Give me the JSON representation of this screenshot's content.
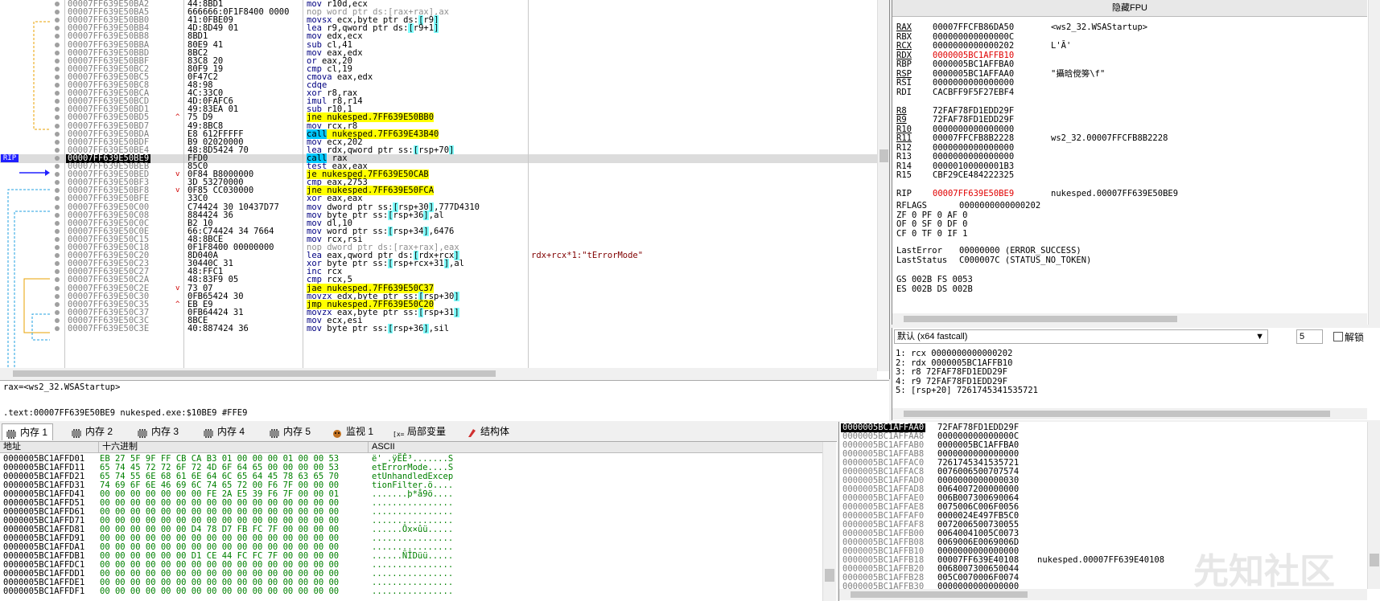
{
  "disasm": {
    "rows": [
      {
        "addr": "00007FF639E50BA2",
        "bytes": "44:8BD1",
        "ins": "mov r10d,ecx",
        "type": "normal"
      },
      {
        "addr": "00007FF639E50BA5",
        "bytes": "666666:0F1F8400 0000",
        "ins": "nop word ptr ds:[rax+rax],ax",
        "type": "nop"
      },
      {
        "addr": "00007FF639E50BB0",
        "bytes": "41:0FBE09",
        "ins": "movsx ecx,byte ptr ds:[r9]",
        "type": "normal"
      },
      {
        "addr": "00007FF639E50BB4",
        "bytes": "4D:8D49 01",
        "ins": "lea r9,qword ptr ds:[r9+1]",
        "type": "normal"
      },
      {
        "addr": "00007FF639E50BB8",
        "bytes": "8BD1",
        "ins": "mov edx,ecx",
        "type": "normal"
      },
      {
        "addr": "00007FF639E50BBA",
        "bytes": "80E9 41",
        "ins": "sub cl,41",
        "type": "normal"
      },
      {
        "addr": "00007FF639E50BBD",
        "bytes": "8BC2",
        "ins": "mov eax,edx",
        "type": "normal"
      },
      {
        "addr": "00007FF639E50BBF",
        "bytes": "83C8 20",
        "ins": "or eax,20",
        "type": "normal"
      },
      {
        "addr": "00007FF639E50BC2",
        "bytes": "80F9 19",
        "ins": "cmp cl,19",
        "type": "normal"
      },
      {
        "addr": "00007FF639E50BC5",
        "bytes": "0F47C2",
        "ins": "cmova eax,edx",
        "type": "normal"
      },
      {
        "addr": "00007FF639E50BC8",
        "bytes": "48:98",
        "ins": "cdqe",
        "type": "normal"
      },
      {
        "addr": "00007FF639E50BCA",
        "bytes": "4C:33C0",
        "ins": "xor r8,rax",
        "type": "normal"
      },
      {
        "addr": "00007FF639E50BCD",
        "bytes": "4D:0FAFC6",
        "ins": "imul r8,r14",
        "type": "normal"
      },
      {
        "addr": "00007FF639E50BD1",
        "bytes": "49:83EA 01",
        "ins": "sub r10,1",
        "type": "normal"
      },
      {
        "addr": "00007FF639E50BD5",
        "bytes": "75 D9",
        "ins": "jne nukesped.7FF639E50BB0",
        "type": "jmp",
        "arrow": "^"
      },
      {
        "addr": "00007FF639E50BD7",
        "bytes": "49:8BC8",
        "ins": "mov rcx,r8",
        "type": "normal"
      },
      {
        "addr": "00007FF639E50BDA",
        "bytes": "E8 612FFFFF",
        "ins": "call nukesped.7FF639E43B40",
        "type": "call"
      },
      {
        "addr": "00007FF639E50BDF",
        "bytes": "B9 02020000",
        "ins": "mov ecx,202",
        "type": "normal"
      },
      {
        "addr": "00007FF639E50BE4",
        "bytes": "48:8D5424 70",
        "ins": "lea rdx,qword ptr ss:[rsp+70]",
        "type": "normal"
      },
      {
        "addr": "00007FF639E50BE9",
        "bytes": "FFD0",
        "ins": "call rax",
        "type": "callreg",
        "current": true
      },
      {
        "addr": "00007FF639E50BEB",
        "bytes": "85C0",
        "ins": "test eax,eax",
        "type": "normal"
      },
      {
        "addr": "00007FF639E50BED",
        "bytes": "0F84 B8000000",
        "ins": "je nukesped.7FF639E50CAB",
        "type": "jmp",
        "arrow": "v"
      },
      {
        "addr": "00007FF639E50BF3",
        "bytes": "3D 53270000",
        "ins": "cmp eax,2753",
        "type": "normal"
      },
      {
        "addr": "00007FF639E50BF8",
        "bytes": "0F85 CC030000",
        "ins": "jne nukesped.7FF639E50FCA",
        "type": "jmp",
        "arrow": "v"
      },
      {
        "addr": "00007FF639E50BFE",
        "bytes": "33C0",
        "ins": "xor eax,eax",
        "type": "normal"
      },
      {
        "addr": "00007FF639E50C00",
        "bytes": "C74424 30 10437D77",
        "ins": "mov dword ptr ss:[rsp+30],777D4310",
        "type": "normal"
      },
      {
        "addr": "00007FF639E50C08",
        "bytes": "884424 36",
        "ins": "mov byte ptr ss:[rsp+36],al",
        "type": "normal"
      },
      {
        "addr": "00007FF639E50C0C",
        "bytes": "B2 10",
        "ins": "mov dl,10",
        "type": "normal"
      },
      {
        "addr": "00007FF639E50C0E",
        "bytes": "66:C74424 34 7664",
        "ins": "mov word ptr ss:[rsp+34],6476",
        "type": "normal"
      },
      {
        "addr": "00007FF639E50C15",
        "bytes": "48:8BCE",
        "ins": "mov rcx,rsi",
        "type": "normal"
      },
      {
        "addr": "00007FF639E50C18",
        "bytes": "0F1F8400 00000000",
        "ins": "nop dword ptr ds:[rax+rax],eax",
        "type": "nop"
      },
      {
        "addr": "00007FF639E50C20",
        "bytes": "8D040A",
        "ins": "lea eax,qword ptr ds:[rdx+rcx]",
        "type": "normal",
        "comment": "rdx+rcx*1:\"tErrorMode\""
      },
      {
        "addr": "00007FF639E50C23",
        "bytes": "30440C 31",
        "ins": "xor byte ptr ss:[rsp+rcx+31],al",
        "type": "normal"
      },
      {
        "addr": "00007FF639E50C27",
        "bytes": "48:FFC1",
        "ins": "inc rcx",
        "type": "normal"
      },
      {
        "addr": "00007FF639E50C2A",
        "bytes": "48:83F9 05",
        "ins": "cmp rcx,5",
        "type": "normal"
      },
      {
        "addr": "00007FF639E50C2E",
        "bytes": "73 07",
        "ins": "jae nukesped.7FF639E50C37",
        "type": "jmp",
        "arrow": "v"
      },
      {
        "addr": "00007FF639E50C30",
        "bytes": "0FB65424 30",
        "ins": "movzx edx,byte ptr ss:[rsp+30]",
        "type": "normal"
      },
      {
        "addr": "00007FF639E50C35",
        "bytes": "EB E9",
        "ins": "jmp nukesped.7FF639E50C20",
        "type": "jmp",
        "arrow": "^"
      },
      {
        "addr": "00007FF639E50C37",
        "bytes": "0FB64424 31",
        "ins": "movzx eax,byte ptr ss:[rsp+31]",
        "type": "normal"
      },
      {
        "addr": "00007FF639E50C3C",
        "bytes": "8BCE",
        "ins": "mov ecx,esi",
        "type": "normal"
      },
      {
        "addr": "00007FF639E50C3E",
        "bytes": "40:887424 36",
        "ins": "mov byte ptr ss:[rsp+36],sil",
        "type": "normal"
      }
    ],
    "rip_label": "RIP"
  },
  "info": {
    "line1": "rax=<ws2_32.WSAStartup>",
    "line2": ".text:00007FF639E50BE9 nukesped.exe:$10BE9 #FFE9"
  },
  "registers": {
    "title": "隐藏FPU",
    "rows": [
      {
        "name": "RAX",
        "value": "00007FFCFB86DA50",
        "comment": "<ws2_32.WSAStartup>",
        "u": true
      },
      {
        "name": "RBX",
        "value": "000000000000000C",
        "comment": ""
      },
      {
        "name": "RCX",
        "value": "0000000000000202",
        "comment": "L'Ȃ'",
        "u": true
      },
      {
        "name": "RDX",
        "value": "0000005BC1AFFB10",
        "comment": "",
        "u": true,
        "red": true
      },
      {
        "name": "RBP",
        "value": "0000005BC1AFFBA0",
        "comment": ""
      },
      {
        "name": "RSP",
        "value": "0000005BC1AFFAA0",
        "comment": "\"攝晗傥篣\\f\"",
        "u": true
      },
      {
        "name": "RSI",
        "value": "0000000000000000",
        "comment": ""
      },
      {
        "name": "RDI",
        "value": "CACBFF9F5F27EBF4",
        "comment": ""
      },
      {
        "name": "",
        "value": "",
        "comment": ""
      },
      {
        "name": "R8",
        "value": "72FAF78FD1EDD29F",
        "comment": "",
        "u": true
      },
      {
        "name": "R9",
        "value": "72FAF78FD1EDD29F",
        "comment": "",
        "u": true
      },
      {
        "name": "R10",
        "value": "0000000000000000",
        "comment": "",
        "u": true
      },
      {
        "name": "R11",
        "value": "00007FFCFB8B2228",
        "comment": "ws2_32.00007FFCFB8B2228",
        "u": true
      },
      {
        "name": "R12",
        "value": "0000000000000000",
        "comment": ""
      },
      {
        "name": "R13",
        "value": "0000000000000000",
        "comment": ""
      },
      {
        "name": "R14",
        "value": "00000100000001B3",
        "comment": ""
      },
      {
        "name": "R15",
        "value": "CBF29CE484222325",
        "comment": ""
      },
      {
        "name": "",
        "value": "",
        "comment": ""
      },
      {
        "name": "RIP",
        "value": "00007FF639E50BE9",
        "comment": "nukesped.00007FF639E50BE9",
        "red": true
      }
    ],
    "rflags_label": "RFLAGS",
    "rflags_value": "0000000000000202",
    "flags": [
      "ZF 0   PF 0   AF 0",
      "OF 0   SF 0   DF 0",
      "CF 0   TF 0   IF 1"
    ],
    "lasterror_label": "LastError",
    "lasterror_value": "00000000 (ERROR_SUCCESS)",
    "laststatus_label": "LastStatus",
    "laststatus_value": "C000007C (STATUS_NO_TOKEN)",
    "segs": [
      "GS 002B  FS 0053",
      "ES 002B  DS 002B"
    ]
  },
  "args": {
    "convention": "默认 (x64 fastcall)",
    "count": "5",
    "unlock_label": "解锁",
    "rows": [
      "1: rcx 0000000000000202",
      "2: rdx 0000005BC1AFFB10",
      "3: r8 72FAF78FD1EDD29F",
      "4: r9 72FAF78FD1EDD29F",
      "5: [rsp+20] 7261745341535721"
    ]
  },
  "tabs": [
    {
      "label": "内存 1",
      "icon": "memory-icon",
      "active": true
    },
    {
      "label": "内存 2",
      "icon": "memory-icon"
    },
    {
      "label": "内存 3",
      "icon": "memory-icon"
    },
    {
      "label": "内存 4",
      "icon": "memory-icon"
    },
    {
      "label": "内存 5",
      "icon": "memory-icon"
    },
    {
      "label": "监视 1",
      "icon": "watch-icon"
    },
    {
      "label": "局部变量",
      "icon": "locals-icon",
      "prefix": "[x=]"
    },
    {
      "label": "结构体",
      "icon": "struct-icon"
    }
  ],
  "dump": {
    "headers": {
      "addr": "地址",
      "hex": "十六进制",
      "ascii": "ASCII"
    },
    "rows": [
      {
        "addr": "0000005BC1AFFD01",
        "hex": "EB 27 5F 9F FF CB CA B3 01 00 00 00 01 00 00 53",
        "ascii": "ë'_.ÿËÊ³.......S"
      },
      {
        "addr": "0000005BC1AFFD11",
        "hex": "65 74 45 72 72 6F 72 4D 6F 64 65 00 00 00 00 53",
        "ascii": "etErrorMode....S"
      },
      {
        "addr": "0000005BC1AFFD21",
        "hex": "65 74 55 6E 68 61 6E 64 6C 65 64 45 78 63 65 70",
        "ascii": "etUnhandledExcep"
      },
      {
        "addr": "0000005BC1AFFD31",
        "hex": "74 69 6F 6E 46 69 6C 74 65 72 00 F6 7F 00 00 00",
        "ascii": "tionFilter.ö...."
      },
      {
        "addr": "0000005BC1AFFD41",
        "hex": "00 00 00 00 00 00 00 FE 2A E5 39 F6 7F 00 00 01",
        "ascii": ".......þ*å9ö...."
      },
      {
        "addr": "0000005BC1AFFD51",
        "hex": "00 00 00 00 00 00 00 00 00 00 00 00 00 00 00 00",
        "ascii": "................"
      },
      {
        "addr": "0000005BC1AFFD61",
        "hex": "00 00 00 00 00 00 00 00 00 00 00 00 00 00 00 00",
        "ascii": "................"
      },
      {
        "addr": "0000005BC1AFFD71",
        "hex": "00 00 00 00 00 00 00 00 00 00 00 00 00 00 00 00",
        "ascii": "................"
      },
      {
        "addr": "0000005BC1AFFD81",
        "hex": "00 00 00 00 00 00 D4 78 D7 FB FC 7F 00 00 00 00",
        "ascii": "......Ôx×ûü....."
      },
      {
        "addr": "0000005BC1AFFD91",
        "hex": "00 00 00 00 00 00 00 00 00 00 00 00 00 00 00 00",
        "ascii": "................"
      },
      {
        "addr": "0000005BC1AFFDA1",
        "hex": "00 00 00 00 00 00 00 00 00 00 00 00 00 00 00 00",
        "ascii": "................"
      },
      {
        "addr": "0000005BC1AFFDB1",
        "hex": "00 00 00 00 00 00 D1 CE 44 FC FC 7F 00 00 00 00",
        "ascii": "......ÑÎDüü....."
      },
      {
        "addr": "0000005BC1AFFDC1",
        "hex": "00 00 00 00 00 00 00 00 00 00 00 00 00 00 00 00",
        "ascii": "................"
      },
      {
        "addr": "0000005BC1AFFDD1",
        "hex": "00 00 00 00 00 00 00 00 00 00 00 00 00 00 00 00",
        "ascii": "................"
      },
      {
        "addr": "0000005BC1AFFDE1",
        "hex": "00 00 00 00 00 00 00 00 00 00 00 00 00 00 00 00",
        "ascii": "................"
      },
      {
        "addr": "0000005BC1AFFDF1",
        "hex": "00 00 00 00 00 00 00 00 00 00 00 00 00 00 00 00",
        "ascii": "................"
      }
    ]
  },
  "stack": {
    "rows": [
      {
        "addr": "0000005BC1AFFAA0",
        "val": "72FAF78FD1EDD29F",
        "cmt": "",
        "top": true
      },
      {
        "addr": "0000005BC1AFFAA8",
        "val": "000000000000000C",
        "cmt": ""
      },
      {
        "addr": "0000005BC1AFFAB0",
        "val": "0000005BC1AFFBA0",
        "cmt": ""
      },
      {
        "addr": "0000005BC1AFFAB8",
        "val": "0000000000000000",
        "cmt": ""
      },
      {
        "addr": "0000005BC1AFFAC0",
        "val": "7261745341535721",
        "cmt": ""
      },
      {
        "addr": "0000005BC1AFFAC8",
        "val": "0076006500707574",
        "cmt": ""
      },
      {
        "addr": "0000005BC1AFFAD0",
        "val": "0000000000000030",
        "cmt": ""
      },
      {
        "addr": "0000005BC1AFFAD8",
        "val": "0064007200000000",
        "cmt": ""
      },
      {
        "addr": "0000005BC1AFFAE0",
        "val": "006B007300690064",
        "cmt": ""
      },
      {
        "addr": "0000005BC1AFFAE8",
        "val": "0075006C006F0056",
        "cmt": ""
      },
      {
        "addr": "0000005BC1AFFAF0",
        "val": "0000024E497FB5C0",
        "cmt": ""
      },
      {
        "addr": "0000005BC1AFFAF8",
        "val": "0072006500730055",
        "cmt": ""
      },
      {
        "addr": "0000005BC1AFFB00",
        "val": "00640041005C0073",
        "cmt": ""
      },
      {
        "addr": "0000005BC1AFFB08",
        "val": "0069006E0069006D",
        "cmt": ""
      },
      {
        "addr": "0000005BC1AFFB10",
        "val": "0000000000000000",
        "cmt": ""
      },
      {
        "addr": "0000005BC1AFFB18",
        "val": "00007FF639E40108",
        "cmt": "nukesped.00007FF639E40108"
      },
      {
        "addr": "0000005BC1AFFB20",
        "val": "0068007300650044",
        "cmt": ""
      },
      {
        "addr": "0000005BC1AFFB28",
        "val": "005C0070006F0074",
        "cmt": ""
      },
      {
        "addr": "0000005BC1AFFB30",
        "val": "0000000000000000",
        "cmt": ""
      }
    ],
    "watermark": "先知社区"
  }
}
